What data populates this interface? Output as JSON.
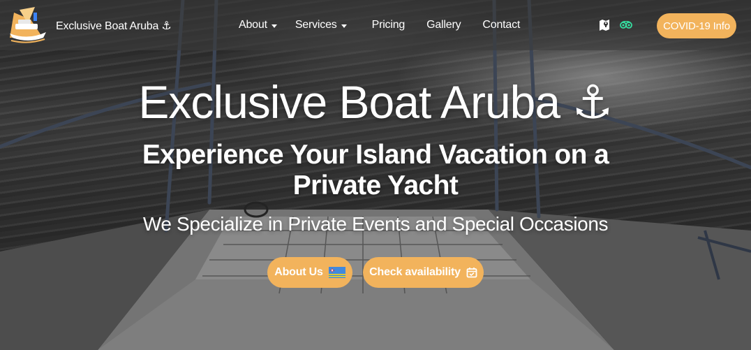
{
  "brand": {
    "name": "Exclusive Boat Aruba ⚓",
    "logo_icon": "yacht-logo-icon"
  },
  "nav": {
    "items": [
      {
        "label": "About",
        "dropdown": true
      },
      {
        "label": "Services",
        "dropdown": true
      },
      {
        "label": "Pricing",
        "dropdown": false
      },
      {
        "label": "Gallery",
        "dropdown": false
      },
      {
        "label": "Contact",
        "dropdown": false
      }
    ],
    "icons": [
      "map-location-icon",
      "tripadvisor-icon"
    ],
    "cta_label": "COVID-19 Info"
  },
  "hero": {
    "title": "Exclusive Boat Aruba ⚓",
    "subtitle": "Experience Your Island Vacation on a Private Yacht",
    "tagline": "We Specialize in Private Events and Special Occasions",
    "buttons": [
      {
        "label": "About Us",
        "icon": "aruba-flag-icon"
      },
      {
        "label": "Check availability",
        "icon": "calendar-check-icon"
      }
    ]
  },
  "colors": {
    "accent": "#f2b35c",
    "nav_bg": "rgba(60,60,60,0.62)",
    "text": "#ffffff"
  }
}
